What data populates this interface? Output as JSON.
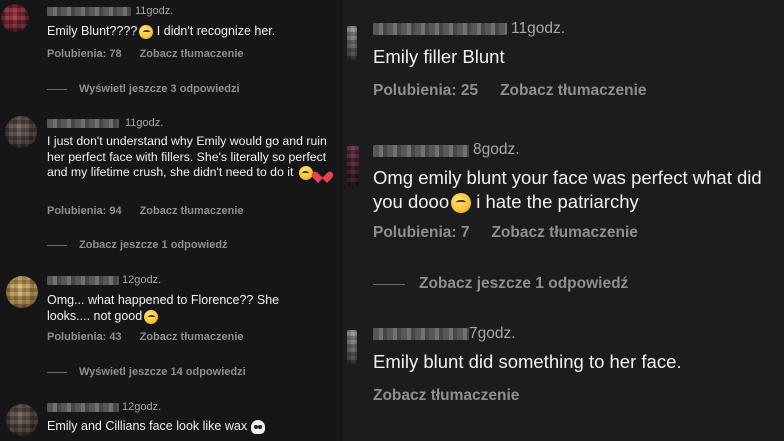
{
  "left": {
    "comments": [
      {
        "time": "11godz.",
        "text": "Emily Blunt????",
        "text_after_emoji": " I didn't recognize her.",
        "emoji": "flushed-face-icon",
        "likes": "Polubienia: 78",
        "translate": "Zobacz tłumaczenie"
      },
      {
        "time": "11godz.",
        "text": "I just don't understand why Emily would go and ruin her perfect face with fillers. She's literally so perfect and my lifetime crush, she didn't need to do it",
        "emoji": [
          "pleading-face-icon",
          "broken-heart-icon"
        ],
        "likes": "Polubienia: 94",
        "translate": "Zobacz tłumaczenie"
      },
      {
        "time": "12godz.",
        "text": "Omg... what happened to Florence?? She looks.... not good",
        "emoji": "grimacing-face-icon",
        "likes": "Polubienia: 43",
        "translate": "Zobacz tłumaczenie"
      },
      {
        "time": "12godz.",
        "text": "Emily and Cillians face look like wax",
        "emoji": "skull-icon"
      }
    ],
    "view_more": [
      "Wyświetl jeszcze 3 odpowiedzi",
      "Zobacz jeszcze 1 odpowiedź",
      "Wyświetl jeszcze 14 odpowiedzi"
    ]
  },
  "right": {
    "comments": [
      {
        "time": "11godz.",
        "text": "Emily filler Blunt",
        "likes": "Polubienia: 25",
        "translate": "Zobacz tłumaczenie"
      },
      {
        "time": "8godz.",
        "text": "Omg emily blunt your face was perfect what did you dooo",
        "text_after_emoji": " i hate the patriarchy",
        "emoji": "tired-face-icon",
        "likes": "Polubienia: 7",
        "translate": "Zobacz tłumaczenie"
      },
      {
        "time": "7godz.",
        "text": "Emily blunt did something to her face.",
        "translate": "Zobacz tłumaczenie"
      }
    ],
    "view_more": "Zobacz jeszcze 1 odpowiedź"
  }
}
